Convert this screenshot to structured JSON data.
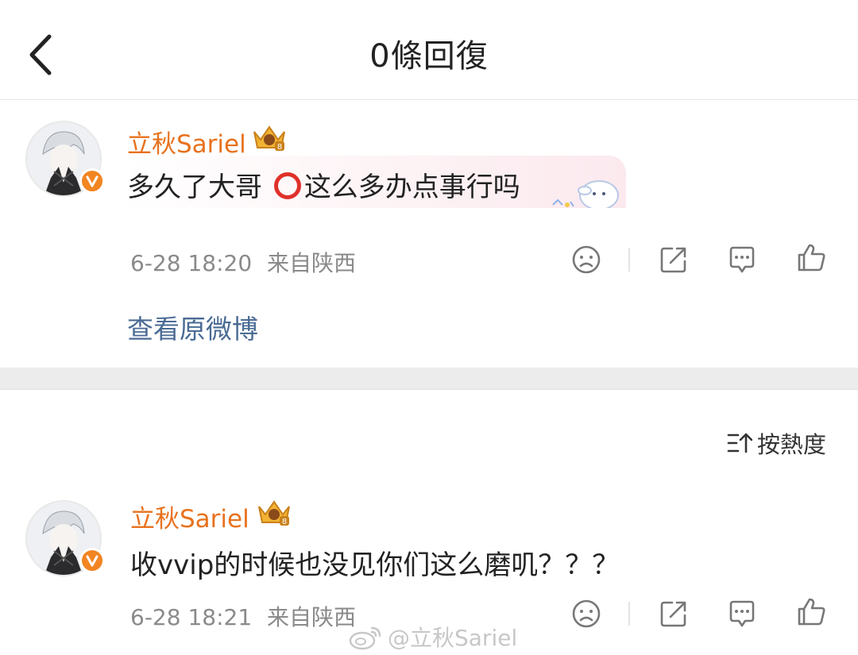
{
  "header": {
    "title": "0條回復"
  },
  "main_comment": {
    "username": "立秋Sariel",
    "text_before": "多久了大哥 ",
    "text_after": "这么多办点事行吗",
    "date": "6-28 18:20",
    "location": "来自陕西"
  },
  "view_original": "查看原微博",
  "sort": {
    "label": "按熱度"
  },
  "reply_comment": {
    "username": "立秋Sariel",
    "text": "收vvip的时候也没见你们这么磨叽？？？",
    "date": "6-28 18:21",
    "location": "来自陕西"
  },
  "watermark": {
    "text": "@立秋Sariel"
  },
  "colors": {
    "username": "#e8721e",
    "link": "#4a6b94",
    "meta": "#8a8a8a",
    "verified_badge": "#f28522"
  },
  "icons": {
    "back": "chevron-left-icon",
    "crown": "crown-icon",
    "dislike": "sad-face-icon",
    "repost": "share-icon",
    "comment": "comment-icon",
    "like": "thumbs-up-icon",
    "sort": "sort-icon"
  }
}
